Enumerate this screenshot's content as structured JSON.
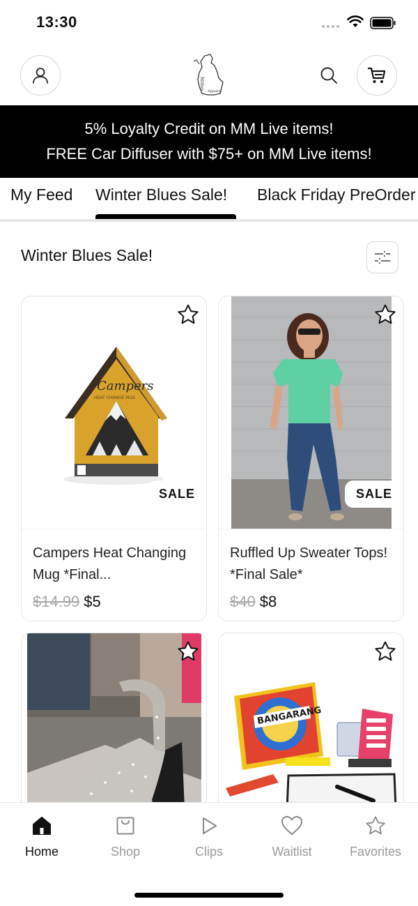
{
  "status_bar": {
    "time": "13:30"
  },
  "header": {
    "account_icon": "person-icon",
    "search_icon": "search-icon",
    "cart_icon": "cart-icon",
    "logo": "michigan-map-logo"
  },
  "promo": {
    "line1": "5% Loyalty Credit on MM Live items!",
    "line2": "FREE Car Diffuser with $75+ on MM Live items!"
  },
  "tabs": [
    {
      "label": "My Feed",
      "active": false
    },
    {
      "label": "Winter Blues Sale!",
      "active": true
    },
    {
      "label": "Black Friday PreOrder",
      "active": false
    }
  ],
  "section": {
    "title": "Winter Blues Sale!",
    "filter_icon": "sliders-icon"
  },
  "products": [
    {
      "name": "Campers Heat Changing Mug *Final...",
      "old_price": "$14.99",
      "price": "$5",
      "badge": "SALE",
      "image": "campers-mug-box"
    },
    {
      "name": "Ruffled Up Sweater Tops! *Final Sale*",
      "old_price": "$40",
      "price": "$8",
      "badge": "SALE",
      "image": "woman-green-top"
    },
    {
      "name": "",
      "old_price": "",
      "price": "",
      "badge": "",
      "image": "rhinestone-heel"
    },
    {
      "name": "",
      "old_price": "",
      "price": "",
      "badge": "",
      "image": "bangarang-game"
    }
  ],
  "bottom_nav": [
    {
      "label": "Home",
      "icon": "home-icon",
      "active": true
    },
    {
      "label": "Shop",
      "icon": "bag-icon",
      "active": false
    },
    {
      "label": "Clips",
      "icon": "play-icon",
      "active": false
    },
    {
      "label": "Waitlist",
      "icon": "heart-icon",
      "active": false
    },
    {
      "label": "Favorites",
      "icon": "star-icon",
      "active": false
    }
  ],
  "colors": {
    "banner_bg": "#000000",
    "text": "#111111",
    "muted": "#9a9a9a",
    "border": "#e3e3e3"
  }
}
